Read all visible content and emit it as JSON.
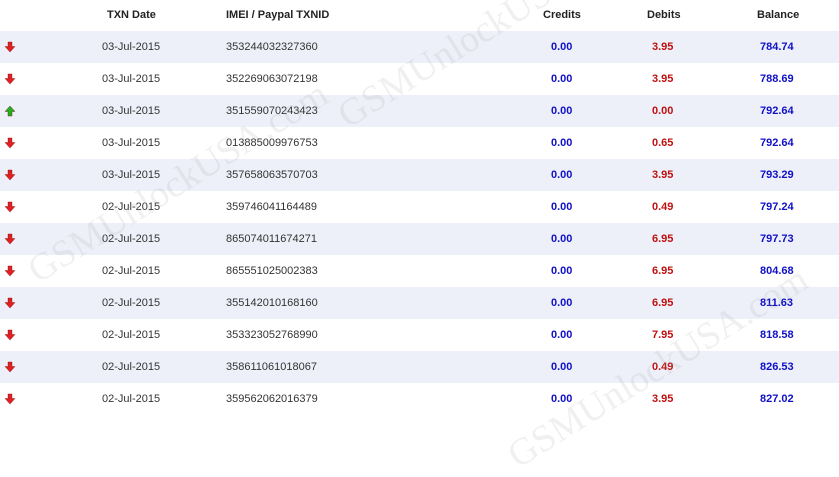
{
  "columns": {
    "date": "TXN Date",
    "id": "IMEI / Paypal TXNID",
    "credits": "Credits",
    "debits": "Debits",
    "balance": "Balance"
  },
  "watermark": "GSMUnlockUSA.com",
  "colors": {
    "row_alt": "#eef0f9",
    "credit": "#1010c8",
    "debit": "#c01010",
    "down_arrow": "#e02020",
    "up_arrow": "#20b020"
  },
  "rows": [
    {
      "dir": "down",
      "date": "03-Jul-2015",
      "id": "353244032327360",
      "credit": "0.00",
      "debit": "3.95",
      "balance": "784.74"
    },
    {
      "dir": "down",
      "date": "03-Jul-2015",
      "id": "352269063072198",
      "credit": "0.00",
      "debit": "3.95",
      "balance": "788.69"
    },
    {
      "dir": "up",
      "date": "03-Jul-2015",
      "id": "351559070243423",
      "credit": "0.00",
      "debit": "0.00",
      "balance": "792.64"
    },
    {
      "dir": "down",
      "date": "03-Jul-2015",
      "id": "013885009976753",
      "credit": "0.00",
      "debit": "0.65",
      "balance": "792.64"
    },
    {
      "dir": "down",
      "date": "03-Jul-2015",
      "id": "357658063570703",
      "credit": "0.00",
      "debit": "3.95",
      "balance": "793.29"
    },
    {
      "dir": "down",
      "date": "02-Jul-2015",
      "id": "359746041164489",
      "credit": "0.00",
      "debit": "0.49",
      "balance": "797.24"
    },
    {
      "dir": "down",
      "date": "02-Jul-2015",
      "id": "865074011674271",
      "credit": "0.00",
      "debit": "6.95",
      "balance": "797.73"
    },
    {
      "dir": "down",
      "date": "02-Jul-2015",
      "id": "865551025002383",
      "credit": "0.00",
      "debit": "6.95",
      "balance": "804.68"
    },
    {
      "dir": "down",
      "date": "02-Jul-2015",
      "id": "355142010168160",
      "credit": "0.00",
      "debit": "6.95",
      "balance": "811.63"
    },
    {
      "dir": "down",
      "date": "02-Jul-2015",
      "id": "353323052768990",
      "credit": "0.00",
      "debit": "7.95",
      "balance": "818.58"
    },
    {
      "dir": "down",
      "date": "02-Jul-2015",
      "id": "358611061018067",
      "credit": "0.00",
      "debit": "0.49",
      "balance": "826.53"
    },
    {
      "dir": "down",
      "date": "02-Jul-2015",
      "id": "359562062016379",
      "credit": "0.00",
      "debit": "3.95",
      "balance": "827.02"
    }
  ]
}
